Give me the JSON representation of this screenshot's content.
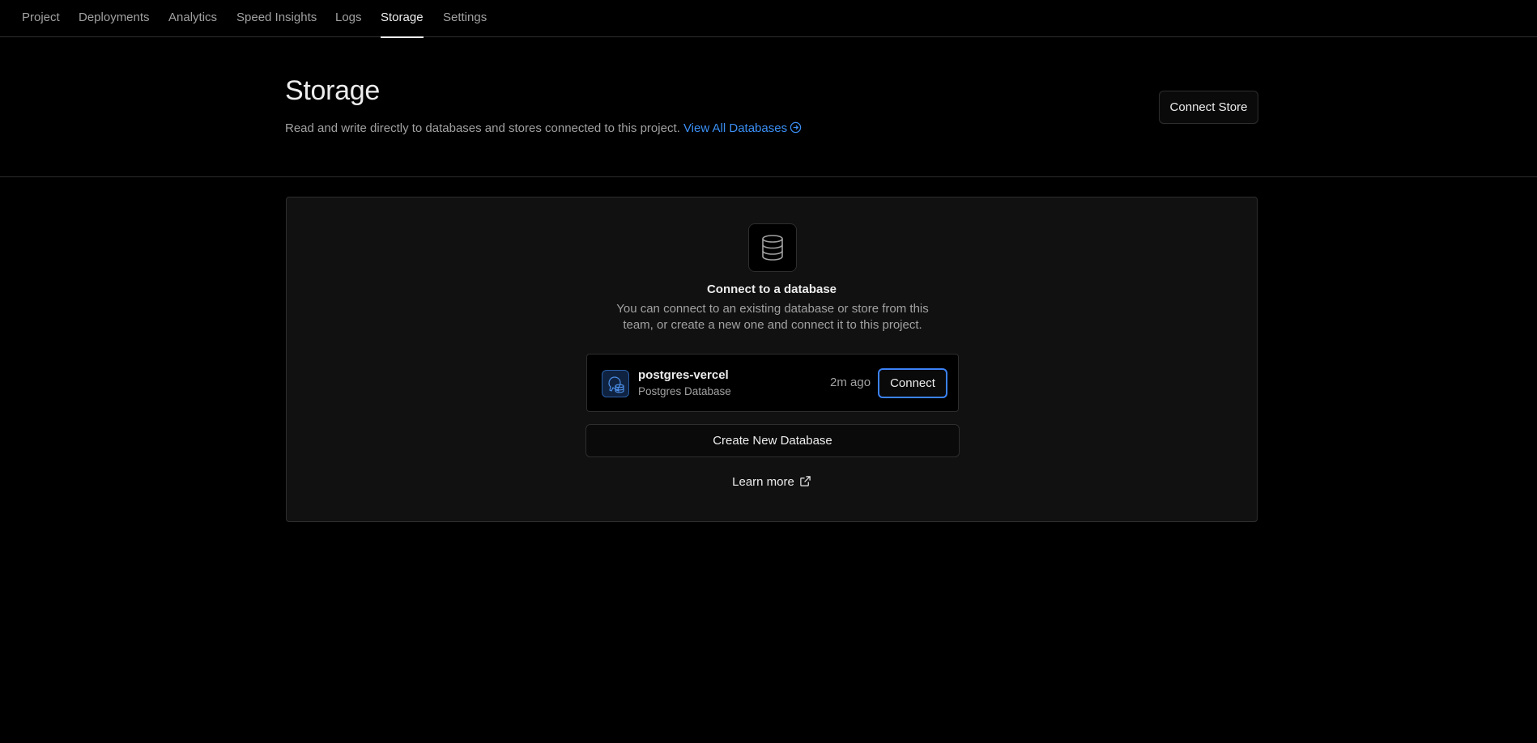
{
  "nav": {
    "tabs": [
      {
        "label": "Project"
      },
      {
        "label": "Deployments"
      },
      {
        "label": "Analytics"
      },
      {
        "label": "Speed Insights"
      },
      {
        "label": "Logs"
      },
      {
        "label": "Storage",
        "active": true
      },
      {
        "label": "Settings"
      }
    ]
  },
  "header": {
    "title": "Storage",
    "description": "Read and write directly to databases and stores connected to this project.",
    "view_all_label": "View All Databases",
    "connect_store_label": "Connect Store"
  },
  "empty_state": {
    "icon": "database-icon",
    "title": "Connect to a database",
    "description": "You can connect to an existing database or store from this team, or create a new one and connect it to this project."
  },
  "databases": [
    {
      "name": "postgres-vercel",
      "type": "Postgres Database",
      "time": "2m ago",
      "connect_label": "Connect",
      "icon": "postgres-icon"
    }
  ],
  "actions": {
    "create_label": "Create New Database",
    "learn_more_label": "Learn more"
  },
  "colors": {
    "background": "#000000",
    "accent_link": "#3b8ff5",
    "focus_ring": "#3b82f6"
  }
}
